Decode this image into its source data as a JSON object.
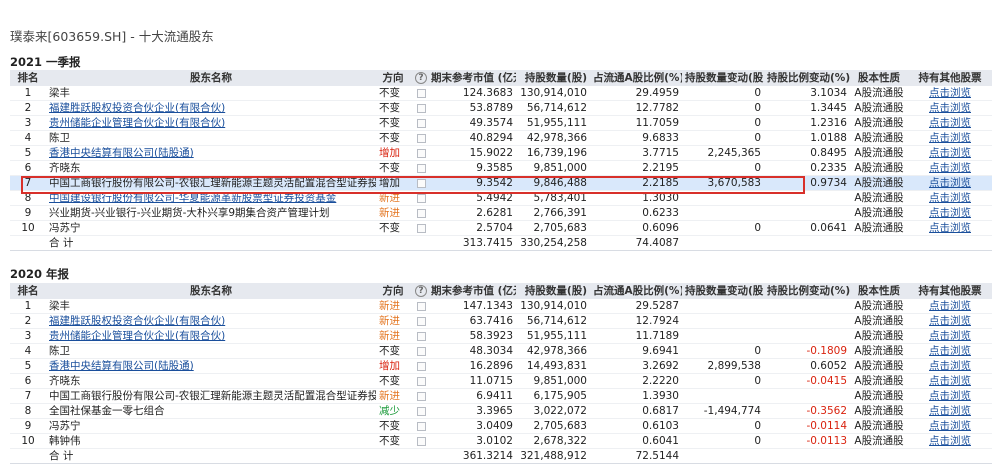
{
  "page": {
    "title": "璞泰来[603659.SH] - 十大流通股东"
  },
  "columns": {
    "rank": "排名",
    "name": "股东名称",
    "direction": "方向",
    "help": "?",
    "mktval": "期末参考市值 (亿元)",
    "shares": "持股数量(股)",
    "ratio": "占流通A股比例(%)",
    "change": "持股数量变动(股)",
    "ratio_change": "持股比例变动(%)",
    "nature": "股本性质",
    "other": "持有其他股票"
  },
  "sections": [
    {
      "title": "2021 一季报",
      "rows": [
        {
          "rank": "1",
          "name": "梁丰",
          "link": false,
          "direction": "不变",
          "dir_class": "",
          "mktval": "124.3683",
          "shares": "130,914,010",
          "ratio": "29.4959",
          "change": "0",
          "ratio_change": "3.1034",
          "neg": false,
          "nature": "A股流通股",
          "other": "点击浏览"
        },
        {
          "rank": "2",
          "name": "福建胜跃股权投资合伙企业(有限合伙)",
          "link": true,
          "direction": "不变",
          "dir_class": "",
          "mktval": "53.8789",
          "shares": "56,714,612",
          "ratio": "12.7782",
          "change": "0",
          "ratio_change": "1.3445",
          "neg": false,
          "nature": "A股流通股",
          "other": "点击浏览"
        },
        {
          "rank": "3",
          "name": "贵州储能企业管理合伙企业(有限合伙)",
          "link": true,
          "direction": "不变",
          "dir_class": "",
          "mktval": "49.3574",
          "shares": "51,955,111",
          "ratio": "11.7059",
          "change": "0",
          "ratio_change": "1.2316",
          "neg": false,
          "nature": "A股流通股",
          "other": "点击浏览"
        },
        {
          "rank": "4",
          "name": "陈卫",
          "link": false,
          "direction": "不变",
          "dir_class": "",
          "mktval": "40.8294",
          "shares": "42,978,366",
          "ratio": "9.6833",
          "change": "0",
          "ratio_change": "1.0188",
          "neg": false,
          "nature": "A股流通股",
          "other": "点击浏览"
        },
        {
          "rank": "5",
          "name": "香港中央结算有限公司(陆股通)",
          "link": true,
          "direction": "增加",
          "dir_class": "dir-up",
          "mktval": "15.9022",
          "shares": "16,739,196",
          "ratio": "3.7715",
          "change": "2,245,365",
          "ratio_change": "0.8495",
          "neg": false,
          "nature": "A股流通股",
          "other": "点击浏览"
        },
        {
          "rank": "6",
          "name": "齐晓东",
          "link": false,
          "direction": "不变",
          "dir_class": "",
          "mktval": "9.3585",
          "shares": "9,851,000",
          "ratio": "2.2195",
          "change": "0",
          "ratio_change": "0.2335",
          "neg": false,
          "nature": "A股流通股",
          "other": "点击浏览"
        },
        {
          "rank": "7",
          "name": "中国工商银行股份有限公司-农银汇理新能源主题灵活配置混合型证券投资基金",
          "link": false,
          "direction": "增加",
          "dir_class": "",
          "mktval": "9.3542",
          "shares": "9,846,488",
          "ratio": "2.2185",
          "change": "3,670,583",
          "ratio_change": "0.9734",
          "neg": false,
          "nature": "A股流通股",
          "other": "点击浏览",
          "highlight": true
        },
        {
          "rank": "8",
          "name": "中国建设银行股份有限公司-华夏能源革新股票型证券投资基金",
          "link": true,
          "direction": "新进",
          "dir_class": "dir-new",
          "mktval": "5.4942",
          "shares": "5,783,401",
          "ratio": "1.3030",
          "change": "",
          "ratio_change": "",
          "neg": false,
          "nature": "A股流通股",
          "other": "点击浏览"
        },
        {
          "rank": "9",
          "name": "兴业期货-兴业银行-兴业期货-大朴兴享9期集合资产管理计划",
          "link": false,
          "direction": "新进",
          "dir_class": "dir-new",
          "mktval": "2.6281",
          "shares": "2,766,391",
          "ratio": "0.6233",
          "change": "",
          "ratio_change": "",
          "neg": false,
          "nature": "A股流通股",
          "other": "点击浏览"
        },
        {
          "rank": "10",
          "name": "冯苏宁",
          "link": false,
          "direction": "不变",
          "dir_class": "",
          "mktval": "2.5704",
          "shares": "2,705,683",
          "ratio": "0.6096",
          "change": "0",
          "ratio_change": "0.0641",
          "neg": false,
          "nature": "A股流通股",
          "other": "点击浏览"
        }
      ],
      "total": {
        "label": "合 计",
        "mktval": "313.7415",
        "shares": "330,254,258",
        "ratio": "74.4087"
      }
    },
    {
      "title": "2020 年报",
      "rows": [
        {
          "rank": "1",
          "name": "梁丰",
          "link": false,
          "direction": "新进",
          "dir_class": "dir-new",
          "mktval": "147.1343",
          "shares": "130,914,010",
          "ratio": "29.5287",
          "change": "",
          "ratio_change": "",
          "neg": false,
          "nature": "A股流通股",
          "other": "点击浏览"
        },
        {
          "rank": "2",
          "name": "福建胜跃股权投资合伙企业(有限合伙)",
          "link": true,
          "direction": "新进",
          "dir_class": "dir-new",
          "mktval": "63.7416",
          "shares": "56,714,612",
          "ratio": "12.7924",
          "change": "",
          "ratio_change": "",
          "neg": false,
          "nature": "A股流通股",
          "other": "点击浏览"
        },
        {
          "rank": "3",
          "name": "贵州储能企业管理合伙企业(有限合伙)",
          "link": true,
          "direction": "新进",
          "dir_class": "dir-new",
          "mktval": "58.3923",
          "shares": "51,955,111",
          "ratio": "11.7189",
          "change": "",
          "ratio_change": "",
          "neg": false,
          "nature": "A股流通股",
          "other": "点击浏览"
        },
        {
          "rank": "4",
          "name": "陈卫",
          "link": false,
          "direction": "不变",
          "dir_class": "",
          "mktval": "48.3034",
          "shares": "42,978,366",
          "ratio": "9.6941",
          "change": "0",
          "ratio_change": "-0.1809",
          "neg": true,
          "nature": "A股流通股",
          "other": "点击浏览"
        },
        {
          "rank": "5",
          "name": "香港中央结算有限公司(陆股通)",
          "link": true,
          "direction": "增加",
          "dir_class": "dir-up",
          "mktval": "16.2896",
          "shares": "14,493,831",
          "ratio": "3.2692",
          "change": "2,899,538",
          "ratio_change": "0.6052",
          "neg": false,
          "nature": "A股流通股",
          "other": "点击浏览"
        },
        {
          "rank": "6",
          "name": "齐晓东",
          "link": false,
          "direction": "不变",
          "dir_class": "",
          "mktval": "11.0715",
          "shares": "9,851,000",
          "ratio": "2.2220",
          "change": "0",
          "ratio_change": "-0.0415",
          "neg": true,
          "nature": "A股流通股",
          "other": "点击浏览"
        },
        {
          "rank": "7",
          "name": "中国工商银行股份有限公司-农银汇理新能源主题灵活配置混合型证券投资基金",
          "link": false,
          "direction": "新进",
          "dir_class": "dir-new",
          "mktval": "6.9411",
          "shares": "6,175,905",
          "ratio": "1.3930",
          "change": "",
          "ratio_change": "",
          "neg": false,
          "nature": "A股流通股",
          "other": "点击浏览"
        },
        {
          "rank": "8",
          "name": "全国社保基金一零七组合",
          "link": false,
          "direction": "减少",
          "dir_class": "dir-down",
          "mktval": "3.3965",
          "shares": "3,022,072",
          "ratio": "0.6817",
          "change": "-1,494,774",
          "ratio_change": "-0.3562",
          "neg": true,
          "nature": "A股流通股",
          "other": "点击浏览"
        },
        {
          "rank": "9",
          "name": "冯苏宁",
          "link": false,
          "direction": "不变",
          "dir_class": "",
          "mktval": "3.0409",
          "shares": "2,705,683",
          "ratio": "0.6103",
          "change": "0",
          "ratio_change": "-0.0114",
          "neg": true,
          "nature": "A股流通股",
          "other": "点击浏览"
        },
        {
          "rank": "10",
          "name": "韩钟伟",
          "link": false,
          "direction": "不变",
          "dir_class": "",
          "mktval": "3.0102",
          "shares": "2,678,322",
          "ratio": "0.6041",
          "change": "0",
          "ratio_change": "-0.0113",
          "neg": true,
          "nature": "A股流通股",
          "other": "点击浏览"
        }
      ],
      "total": {
        "label": "合 计",
        "mktval": "361.3214",
        "shares": "321,488,912",
        "ratio": "72.5144"
      }
    }
  ]
}
